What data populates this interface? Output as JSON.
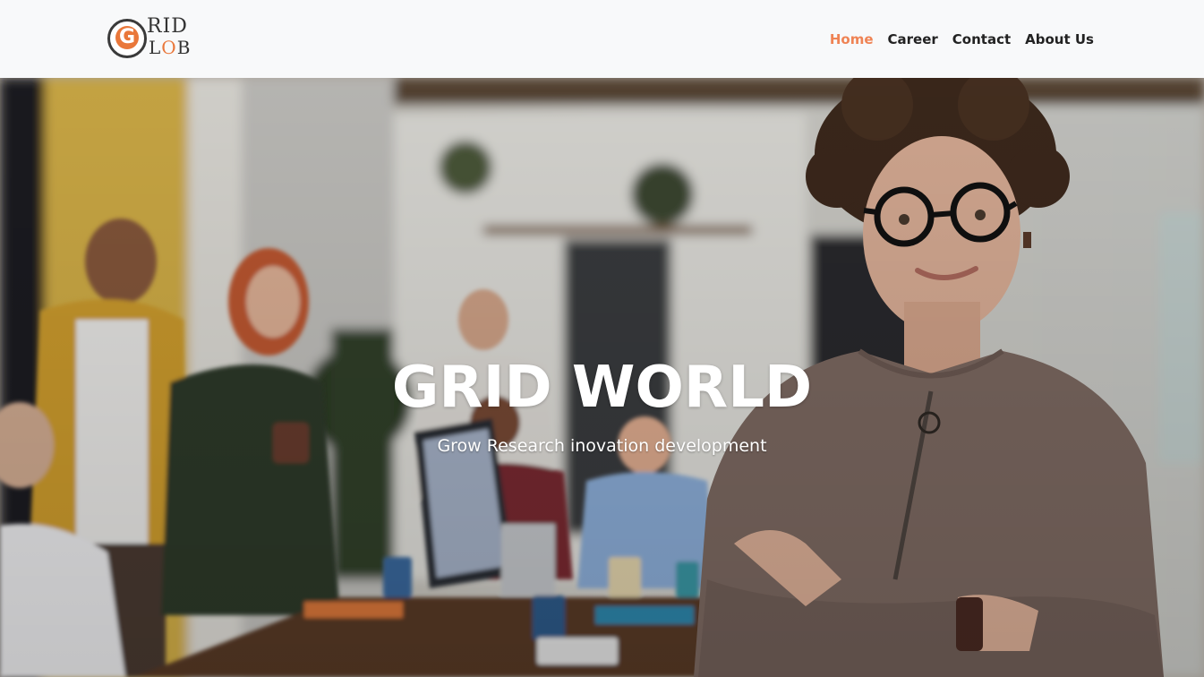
{
  "brand": {
    "logo_letter": "G",
    "logo_line1": "RID",
    "logo_line2a": "L",
    "logo_line2b": "O",
    "logo_line2c": "B"
  },
  "nav": {
    "items": [
      {
        "label": "Home",
        "active": true
      },
      {
        "label": "Career",
        "active": false
      },
      {
        "label": "Contact",
        "active": false
      },
      {
        "label": "About Us",
        "active": false
      }
    ]
  },
  "hero": {
    "title": "GRID WORLD",
    "subtitle": "Grow Research inovation development"
  },
  "colors": {
    "accent": "#ef8354",
    "nav_bg": "#f8f9fa",
    "text": "#222222"
  }
}
